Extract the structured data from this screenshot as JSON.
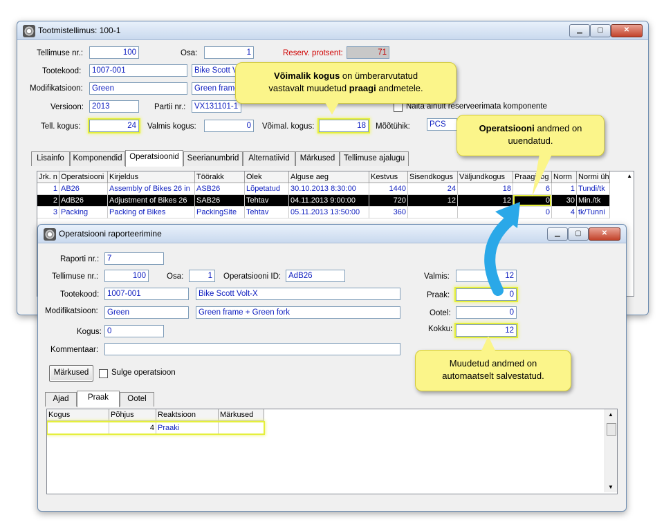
{
  "main_window": {
    "title": "Tootmistellimus: 100-1",
    "fields": {
      "order_no_label": "Tellimuse nr.:",
      "order_no": "100",
      "part_label": "Osa:",
      "part": "1",
      "reserve_label": "Reserv. protsent:",
      "reserve": "71",
      "product_code_label": "Tootekood:",
      "product_code": "1007-001",
      "product_name": "Bike Scott V",
      "modification_label": "Modifikatsioon:",
      "modification": "Green",
      "modification_desc": "Green frame",
      "version_label": "Versioon:",
      "version": "2013",
      "batch_label": "Partii nr.:",
      "batch": "VX131101-1",
      "show_components_label": "Näita ainult reserveerimata komponente",
      "order_qty_label": "Tell. kogus:",
      "order_qty": "24",
      "ready_qty_label": "Valmis kogus:",
      "ready_qty": "0",
      "possible_qty_label": "Võimal. kogus:",
      "possible_qty": "18",
      "unit_label": "Mõõtühik:",
      "unit": "PCS"
    },
    "tabs": [
      "Lisainfo",
      "Komponendid",
      "Operatsioonid",
      "Seerianumbrid",
      "Alternatiivid",
      "Märkused",
      "Tellimuse ajalugu"
    ],
    "ops_table": {
      "headers": [
        "Jrk. n",
        "Operatsiooni",
        "Kirjeldus",
        "Töörakk",
        "Olek",
        "Alguse aeg",
        "Kestvus",
        "Sisendkogus",
        "Väljundkogus",
        "Praagikog",
        "Norm",
        "Normi üh"
      ],
      "rows": [
        [
          "1",
          "AB26",
          "Assembly of Bikes 26 in",
          "ASB26",
          "Lõpetatud",
          "30.10.2013 8:30:00",
          "1440",
          "24",
          "18",
          "6",
          "1",
          "Tundi/tk"
        ],
        [
          "2",
          "AdB26",
          "Adjustment of Bikes 26",
          "SAB26",
          "Tehtav",
          "04.11.2013 9:00:00",
          "720",
          "12",
          "12",
          "0",
          "30",
          "Min./tk"
        ],
        [
          "3",
          "Packing",
          "Packing of Bikes",
          "PackingSite",
          "Tehtav",
          "05.11.2013 13:50:00",
          "360",
          "",
          "",
          "0",
          "4",
          "tk/Tunni"
        ]
      ]
    }
  },
  "report_window": {
    "title": "Operatsiooni raporteerimine",
    "report_no_label": "Raporti nr.:",
    "report_no": "7",
    "order_no_label": "Tellimuse nr.:",
    "order_no": "100",
    "part_label": "Osa:",
    "part": "1",
    "op_id_label": "Operatsiooni ID:",
    "op_id": "AdB26",
    "product_code_label": "Tootekood:",
    "product_code": "1007-001",
    "product_name": "Bike Scott Volt-X",
    "modification_label": "Modifikatsioon:",
    "modification": "Green",
    "modification_desc": "Green frame + Green fork",
    "qty_label": "Kogus:",
    "qty": "0",
    "comment_label": "Kommentaar:",
    "comment": "",
    "ready_label": "Valmis:",
    "ready": "12",
    "scrap_label": "Praak:",
    "scrap": "0",
    "waiting_label": "Ootel:",
    "waiting": "0",
    "total_label": "Kokku:",
    "total": "12",
    "notes_button": "Märkused",
    "close_op_label": "Sulge operatsioon",
    "tabs": [
      "Ajad",
      "Praak",
      "Ootel"
    ],
    "scrap_table": {
      "headers": [
        "Kogus",
        "Põhjus",
        "Reaktsioon",
        "Märkused"
      ],
      "rows": [
        [
          "",
          "4",
          "Praaki",
          ""
        ]
      ]
    }
  },
  "callouts": {
    "c1_bold1": "Võimalik kogus",
    "c1_text1": " on ümberarvutatud",
    "c1_text2": "vastavalt muudetud ",
    "c1_bold2": "praagi",
    "c1_text3": " andmetele.",
    "c2_bold": "Operatsiooni",
    "c2_text1": " andmed on",
    "c2_text2": "uuendatud.",
    "c3_line1": "Muudetud andmed on",
    "c3_line2": "automaatselt salvestatud."
  },
  "colors": {
    "highlight": "#e5ef3c",
    "callout": "#fbf58a",
    "arrow": "#2aa8e8"
  }
}
